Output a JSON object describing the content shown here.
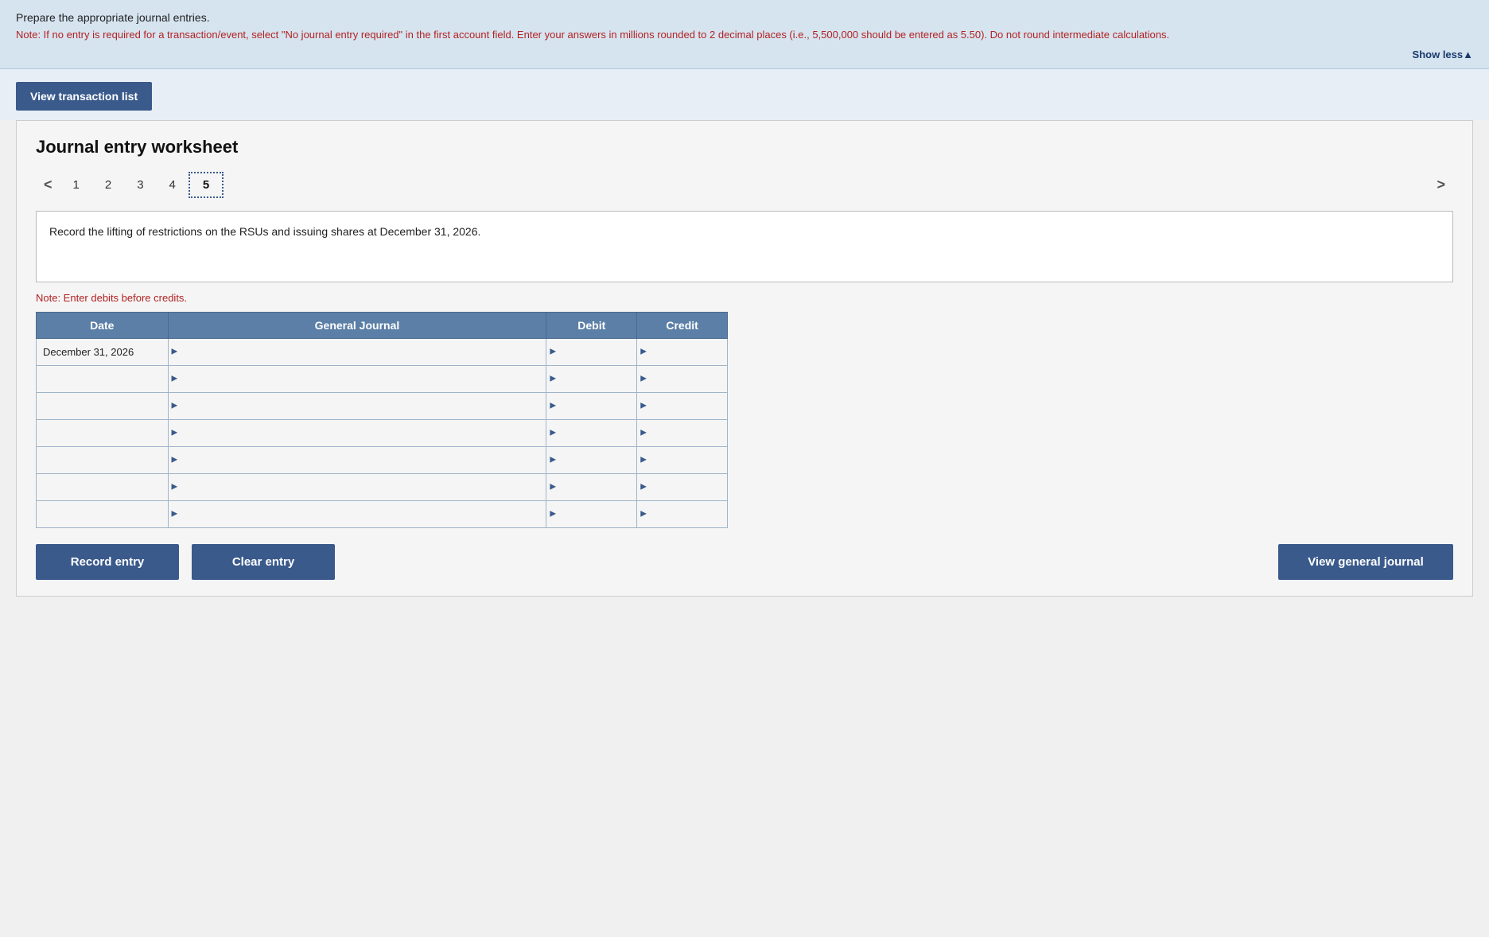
{
  "instructions": {
    "title": "Prepare the appropriate journal entries.",
    "note": "Note: If no entry is required for a transaction/event, select \"No journal entry required\" in the first account field. Enter your answers in millions rounded to 2 decimal places (i.e., 5,500,000 should be entered as 5.50). Do not round intermediate calculations.",
    "show_less_label": "Show less▲"
  },
  "buttons": {
    "view_transaction_list": "View transaction list",
    "record_entry": "Record entry",
    "clear_entry": "Clear entry",
    "view_general_journal": "View general journal"
  },
  "worksheet": {
    "title": "Journal entry worksheet",
    "tabs": [
      "1",
      "2",
      "3",
      "4",
      "5"
    ],
    "active_tab_index": 4,
    "description": "Record the lifting of restrictions on the RSUs and issuing shares at December 31, 2026.",
    "note_debits": "Note: Enter debits before credits.",
    "table": {
      "headers": [
        "Date",
        "General Journal",
        "Debit",
        "Credit"
      ],
      "rows": [
        {
          "date": "December 31, 2026",
          "journal": "",
          "debit": "",
          "credit": ""
        },
        {
          "date": "",
          "journal": "",
          "debit": "",
          "credit": ""
        },
        {
          "date": "",
          "journal": "",
          "debit": "",
          "credit": ""
        },
        {
          "date": "",
          "journal": "",
          "debit": "",
          "credit": ""
        },
        {
          "date": "",
          "journal": "",
          "debit": "",
          "credit": ""
        },
        {
          "date": "",
          "journal": "",
          "debit": "",
          "credit": ""
        },
        {
          "date": "",
          "journal": "",
          "debit": "",
          "credit": ""
        }
      ]
    }
  }
}
